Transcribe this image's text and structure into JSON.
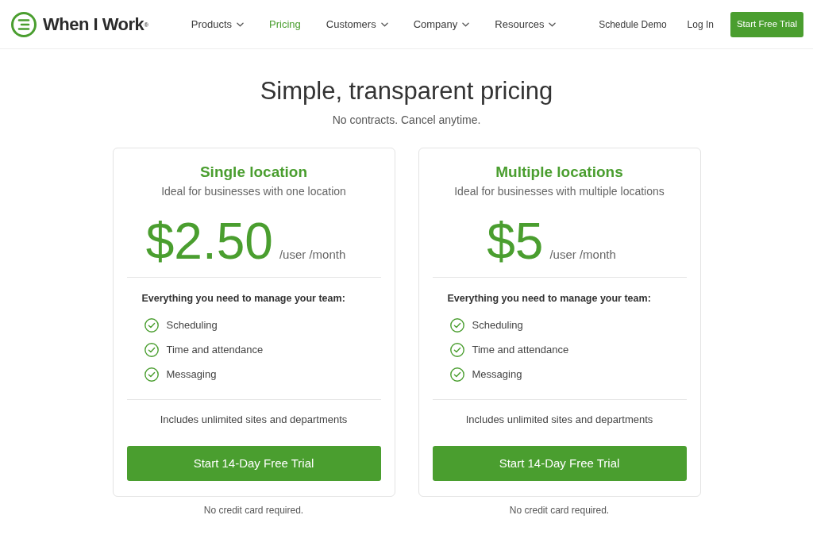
{
  "header": {
    "logo": {
      "text": "When I Work$^{®}$"
    },
    "nav": [
      {
        "label": "Products",
        "has_menu": true,
        "selected": false
      },
      {
        "label": "Pricing",
        "has_menu": false,
        "selected": true
      },
      {
        "label": "Customers",
        "has_menu": true,
        "selected": false
      },
      {
        "label": "Company",
        "has_menu": true,
        "selected": false
      },
      {
        "label": "Resources",
        "has_menu": true,
        "selected": false
      }
    ],
    "links": [
      "Schedule Demo",
      "Log In"
    ],
    "cta": "Start Free Trial"
  },
  "hero": {
    "title": "Simple, transparent pricing",
    "subtitle": "No contracts. Cancel anytime."
  },
  "plans": [
    {
      "name": "Single location",
      "description": "Ideal for businesses with one location",
      "price": "$2.50",
      "unit": "/user /month",
      "features_heading": "Everything you need to manage your team:",
      "features": [
        "Scheduling",
        "Time and attendance",
        "Messaging"
      ],
      "includes": "Includes unlimited sites and departments",
      "button": "Start 14-Day Free Trial",
      "note": "No credit card required."
    },
    {
      "name": "Multiple locations",
      "description": "Ideal for businesses with multiple locations",
      "price": "$5",
      "unit": "/user /month",
      "features_heading": "Everything you need to manage your team:",
      "features": [
        "Scheduling",
        "Time and attendance",
        "Messaging"
      ],
      "includes": "Includes unlimited sites and departments",
      "button": "Start 14-Day Free Trial",
      "note": "No credit card required."
    }
  ]
}
